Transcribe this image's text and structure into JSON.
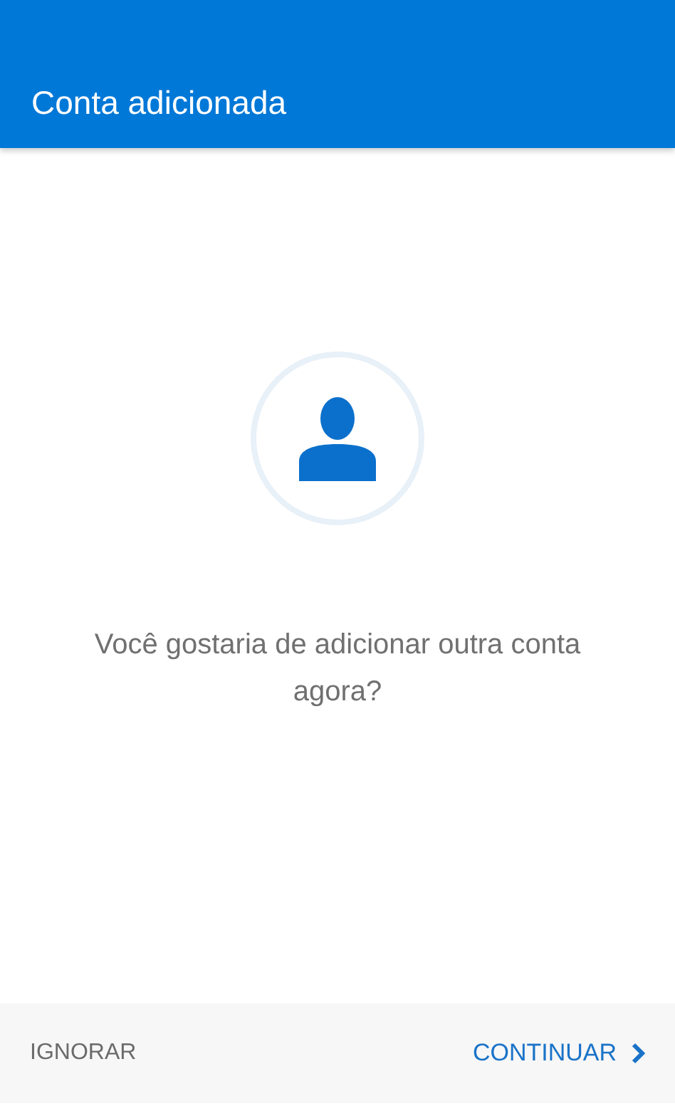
{
  "header": {
    "title": "Conta adicionada"
  },
  "prompt": "Você gostaria de adicionar outra conta agora?",
  "footer": {
    "skip_button": "IGNORAR",
    "continue_button": "CONTINUAR"
  }
}
